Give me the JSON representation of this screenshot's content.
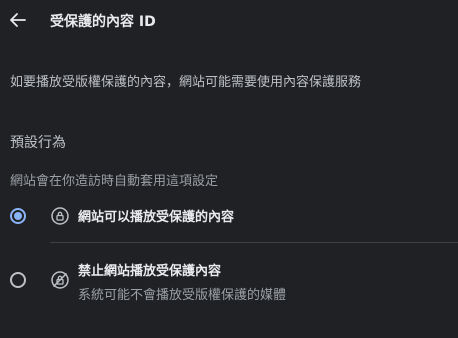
{
  "header": {
    "back_icon": "arrow-back-icon",
    "title": "受保護的內容 ID"
  },
  "description": "如要播放受版權保護的內容，網站可能需要使用內容保護服務",
  "default_behavior": {
    "title": "預設行為",
    "subtitle": "網站會在你造訪時自動套用這項設定",
    "options": [
      {
        "label": "網站可以播放受保護的內容",
        "sublabel": "",
        "icon": "protected-content-icon",
        "selected": true
      },
      {
        "label": "禁止網站播放受保護內容",
        "sublabel": "系統可能不會播放受版權保護的媒體",
        "icon": "protected-content-off-icon",
        "selected": false
      }
    ]
  },
  "colors": {
    "background": "#202124",
    "accent": "#8ab4f8",
    "text_primary": "#e8eaed",
    "text_secondary": "#9aa0a6"
  }
}
